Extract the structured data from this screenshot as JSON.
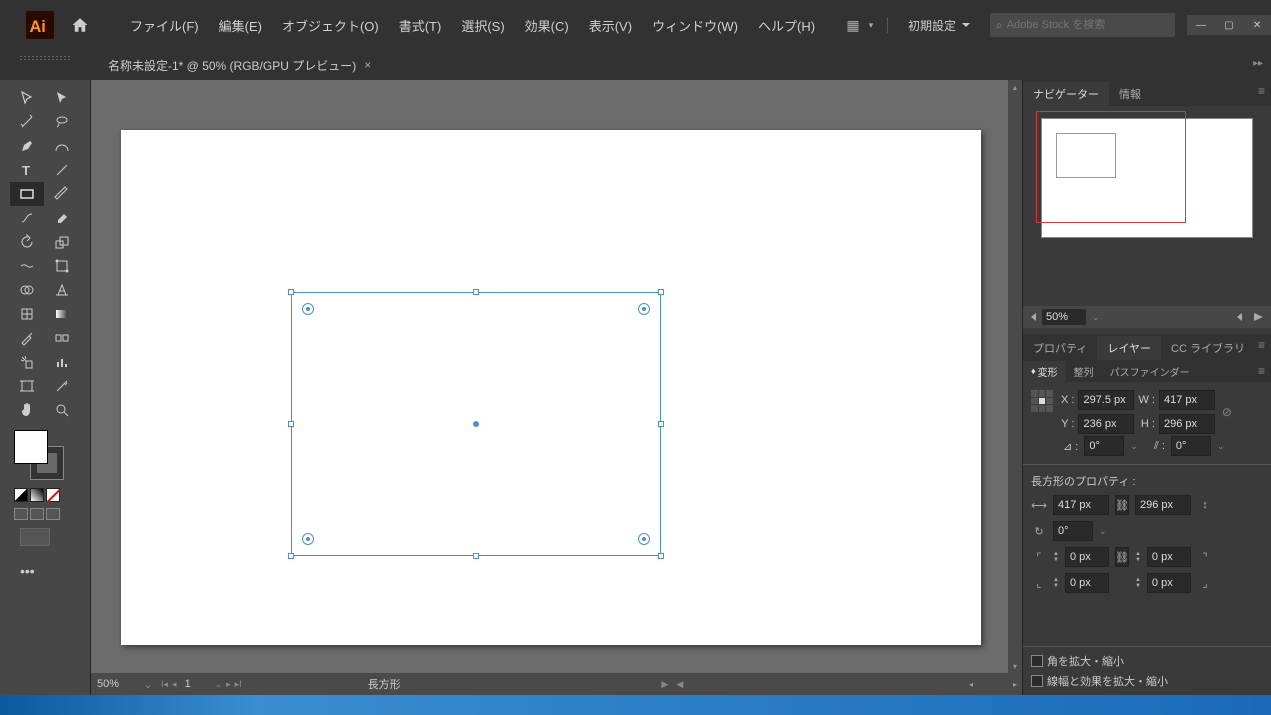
{
  "menubar": {
    "items": [
      "ファイル(F)",
      "編集(E)",
      "オブジェクト(O)",
      "書式(T)",
      "選択(S)",
      "効果(C)",
      "表示(V)",
      "ウィンドウ(W)",
      "ヘルプ(H)"
    ],
    "workspace": "初期設定",
    "search_placeholder": "Adobe Stock を検索"
  },
  "tab": {
    "title": "名称未設定-1* @ 50% (RGB/GPU プレビュー)"
  },
  "navigator": {
    "tabs": [
      "ナビゲーター",
      "情報"
    ],
    "zoom": "50%"
  },
  "properties": {
    "main_tabs": [
      "プロパティ",
      "レイヤー",
      "CC ライブラリ"
    ],
    "sub_tabs": [
      "変形",
      "整列",
      "パスファインダー"
    ],
    "x_label": "X :",
    "x": "297.5 px",
    "y_label": "Y :",
    "y": "236 px",
    "w_label": "W :",
    "w": "417 px",
    "h_label": "H :",
    "h": "296 px",
    "angle_label": "⊿ :",
    "angle": "0°",
    "shear_label": "⫽ :",
    "shear": "0°",
    "rect_title": "長方形のプロパティ :",
    "rect_w": "417 px",
    "rect_h": "296 px",
    "rect_angle": "0°",
    "corner_tl": "0 px",
    "corner_tr": "0 px",
    "corner_bl": "0 px",
    "corner_br": "0 px",
    "chk1": "角を拡大・縮小",
    "chk2": "線幅と効果を拡大・縮小"
  },
  "status": {
    "zoom": "50%",
    "page": "1",
    "object": "長方形"
  }
}
